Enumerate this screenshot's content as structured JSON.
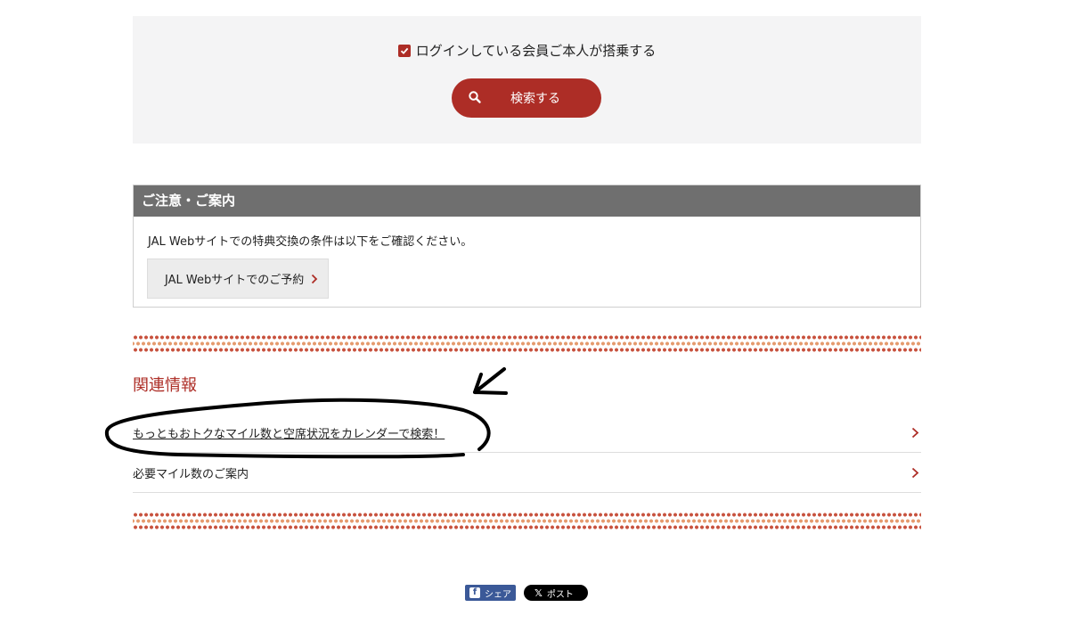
{
  "search_panel": {
    "checkbox_label": "ログインしている会員ご本人が搭乗する",
    "checkbox_checked": true,
    "search_button_label": "検索する"
  },
  "notice": {
    "title": "ご注意・ご案内",
    "text": "JAL Webサイトでの特典交換の条件は以下をご確認ください。",
    "button_label": "JAL Webサイトでのご予約"
  },
  "related": {
    "title": "関連情報",
    "links": [
      {
        "label": "もっともおトクなマイル数と空席状況をカレンダーで検索！"
      },
      {
        "label": "必要マイル数のご案内"
      }
    ]
  },
  "share": {
    "facebook_label": "シェア",
    "x_label": "ポスト"
  },
  "colors": {
    "accent": "#ad2d26",
    "header_gray": "#6f6f6f",
    "panel_bg": "#f4f4f5",
    "facebook": "#3b5998"
  }
}
